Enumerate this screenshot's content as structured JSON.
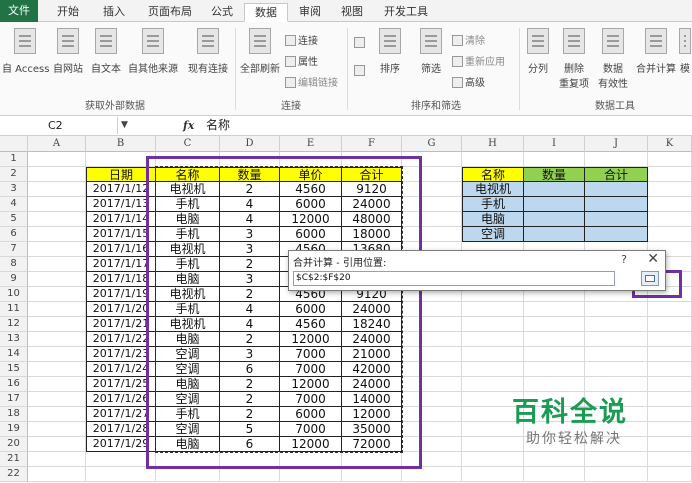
{
  "tabs": [
    "文件",
    "开始",
    "插入",
    "页面布局",
    "公式",
    "数据",
    "审阅",
    "视图",
    "开发工具"
  ],
  "active_tab": "数据",
  "ribbon": {
    "external": {
      "buttons": [
        "自 Access",
        "自网站",
        "自文本",
        "自其他来源",
        "现有连接"
      ],
      "group": "获取外部数据"
    },
    "connections": {
      "refresh_all": "全部刷新",
      "connections": "连接",
      "properties": "属性",
      "edit_links": "编辑链接",
      "group": "连接"
    },
    "sort_filter": {
      "sort": "排序",
      "filter": "筛选",
      "clear": "清除",
      "reapply": "重新应用",
      "advanced": "高级",
      "group": "排序和筛选"
    },
    "data_tools": {
      "split": "分列",
      "remove_dup_1": "删除",
      "remove_dup_2": "重复项",
      "validation_1": "数据",
      "validation_2": "有效性",
      "consolidate": "合并计算",
      "whatif": "模",
      "group": "数据工具"
    }
  },
  "formula_bar": {
    "name_box": "C2",
    "fx": "fx",
    "content": "名称"
  },
  "columns": [
    "A",
    "B",
    "C",
    "D",
    "E",
    "F",
    "G",
    "H",
    "I",
    "J",
    "K"
  ],
  "rows": [
    "1",
    "2",
    "3",
    "4",
    "5",
    "6",
    "7",
    "8",
    "9",
    "10",
    "11",
    "12",
    "13",
    "14",
    "15",
    "16",
    "17",
    "18",
    "19",
    "20",
    "21",
    "22"
  ],
  "table1": {
    "headers": [
      "日期",
      "名称",
      "数量",
      "单价",
      "合计"
    ],
    "rows": [
      [
        "2017/1/12",
        "电视机",
        "2",
        "4560",
        "9120"
      ],
      [
        "2017/1/13",
        "手机",
        "4",
        "6000",
        "24000"
      ],
      [
        "2017/1/14",
        "电脑",
        "4",
        "12000",
        "48000"
      ],
      [
        "2017/1/15",
        "手机",
        "3",
        "6000",
        "18000"
      ],
      [
        "2017/1/16",
        "电视机",
        "3",
        "4560",
        "13680"
      ],
      [
        "2017/1/17",
        "手机",
        "2",
        "6000",
        "12000"
      ],
      [
        "2017/1/18",
        "电脑",
        "3",
        "12000",
        "36000"
      ],
      [
        "2017/1/19",
        "电视机",
        "2",
        "4560",
        "9120"
      ],
      [
        "2017/1/20",
        "手机",
        "4",
        "6000",
        "24000"
      ],
      [
        "2017/1/21",
        "电视机",
        "4",
        "4560",
        "18240"
      ],
      [
        "2017/1/22",
        "电脑",
        "2",
        "12000",
        "24000"
      ],
      [
        "2017/1/23",
        "空调",
        "3",
        "7000",
        "21000"
      ],
      [
        "2017/1/24",
        "空调",
        "6",
        "7000",
        "42000"
      ],
      [
        "2017/1/25",
        "电脑",
        "2",
        "12000",
        "24000"
      ],
      [
        "2017/1/26",
        "空调",
        "2",
        "7000",
        "14000"
      ],
      [
        "2017/1/27",
        "手机",
        "2",
        "6000",
        "12000"
      ],
      [
        "2017/1/28",
        "空调",
        "5",
        "7000",
        "35000"
      ],
      [
        "2017/1/29",
        "电脑",
        "6",
        "12000",
        "72000"
      ]
    ]
  },
  "table2": {
    "headers": [
      "名称",
      "数量",
      "合计"
    ],
    "items": [
      "电视机",
      "手机",
      "电脑",
      "空调"
    ]
  },
  "dialog": {
    "title": "合并计算 - 引用位置:",
    "help": "?",
    "close": "✕",
    "reference": "$C$2:$F$20"
  },
  "watermark": {
    "title": "百科全说",
    "subtitle": "助你轻松解决"
  },
  "colors": {
    "header_yellow": "#ffff00",
    "header_green": "#92d050",
    "light_blue": "#bdd7ee",
    "highlight_purple": "#7030a0",
    "excel_green": "#217346",
    "watermark_green": "#1b9c54"
  }
}
